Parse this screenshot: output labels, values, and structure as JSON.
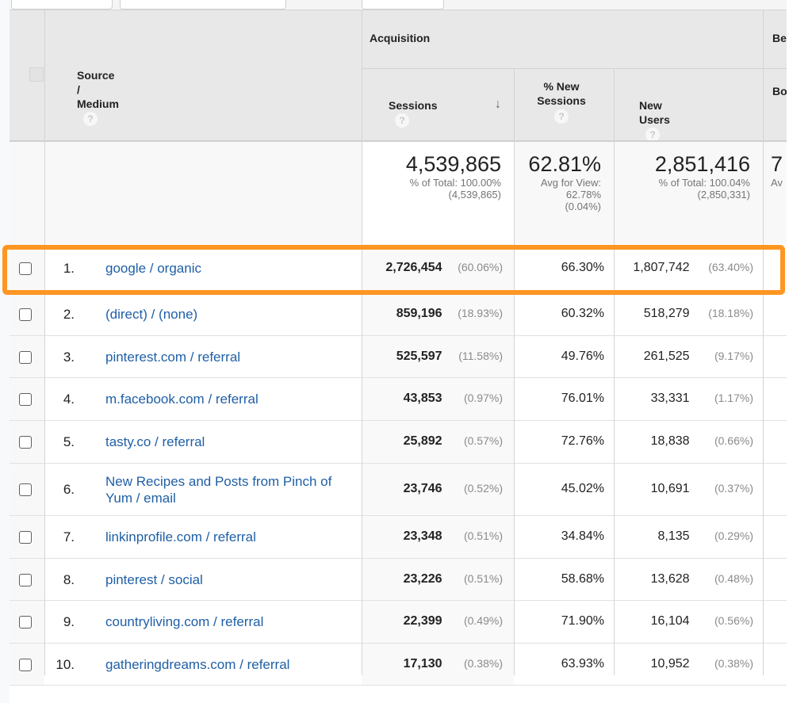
{
  "header": {
    "dimension_label": "Source / Medium",
    "group_acquisition": "Acquisition",
    "group_behavior_partial": "Be",
    "col_sessions": "Sessions",
    "col_new_sessions": "% New Sessions",
    "col_new_sessions_line1": "% New",
    "col_new_sessions_line2": "Sessions",
    "col_new_users": "New Users",
    "col_bounce_partial": "Bo",
    "help_glyph": "?",
    "sort_glyph": "↓"
  },
  "totals": {
    "sessions": "4,539,865",
    "sessions_sub1": "% of Total: 100.00%",
    "sessions_sub2": "(4,539,865)",
    "new_sessions": "62.81%",
    "new_sessions_sub1": "Avg for View:",
    "new_sessions_sub2": "62.78%",
    "new_sessions_sub3": "(0.04%)",
    "new_users": "2,851,416",
    "new_users_sub1": "% of Total: 100.04%",
    "new_users_sub2": "(2,850,331)",
    "bounce_partial": "7",
    "bounce_sub_partial": "Av"
  },
  "rows": [
    {
      "rank": "1.",
      "source": "google / organic",
      "sessions": "2,726,454",
      "sessions_pct": "(60.06%)",
      "new_sessions": "66.30%",
      "new_users": "1,807,742",
      "new_users_pct": "(63.40%)"
    },
    {
      "rank": "2.",
      "source": "(direct) / (none)",
      "sessions": "859,196",
      "sessions_pct": "(18.93%)",
      "new_sessions": "60.32%",
      "new_users": "518,279",
      "new_users_pct": "(18.18%)"
    },
    {
      "rank": "3.",
      "source": "pinterest.com / referral",
      "sessions": "525,597",
      "sessions_pct": "(11.58%)",
      "new_sessions": "49.76%",
      "new_users": "261,525",
      "new_users_pct": "(9.17%)"
    },
    {
      "rank": "4.",
      "source": "m.facebook.com / referral",
      "sessions": "43,853",
      "sessions_pct": "(0.97%)",
      "new_sessions": "76.01%",
      "new_users": "33,331",
      "new_users_pct": "(1.17%)"
    },
    {
      "rank": "5.",
      "source": "tasty.co / referral",
      "sessions": "25,892",
      "sessions_pct": "(0.57%)",
      "new_sessions": "72.76%",
      "new_users": "18,838",
      "new_users_pct": "(0.66%)"
    },
    {
      "rank": "6.",
      "source": "New Recipes and Posts from Pinch of Yum / email",
      "sessions": "23,746",
      "sessions_pct": "(0.52%)",
      "new_sessions": "45.02%",
      "new_users": "10,691",
      "new_users_pct": "(0.37%)"
    },
    {
      "rank": "7.",
      "source": "linkinprofile.com / referral",
      "sessions": "23,348",
      "sessions_pct": "(0.51%)",
      "new_sessions": "34.84%",
      "new_users": "8,135",
      "new_users_pct": "(0.29%)"
    },
    {
      "rank": "8.",
      "source": "pinterest / social",
      "sessions": "23,226",
      "sessions_pct": "(0.51%)",
      "new_sessions": "58.68%",
      "new_users": "13,628",
      "new_users_pct": "(0.48%)"
    },
    {
      "rank": "9.",
      "source": "countryliving.com / referral",
      "sessions": "22,399",
      "sessions_pct": "(0.49%)",
      "new_sessions": "71.90%",
      "new_users": "16,104",
      "new_users_pct": "(0.56%)"
    },
    {
      "rank": "10.",
      "source": "gatheringdreams.com / referral",
      "sessions": "17,130",
      "sessions_pct": "(0.38%)",
      "new_sessions": "63.93%",
      "new_users": "10,952",
      "new_users_pct": "(0.38%)"
    }
  ],
  "highlight": {
    "row_rank": "1.",
    "color": "#ff9622"
  },
  "colors": {
    "link": "#1f5fa6",
    "header_bg": "#e8e8e8",
    "highlight": "#ff9622"
  }
}
